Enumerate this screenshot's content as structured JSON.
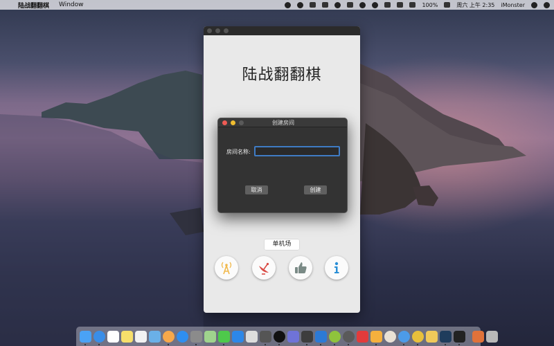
{
  "menubar": {
    "app_name": "陆战翻翻棋",
    "menus": [
      "Window"
    ],
    "battery": "100%",
    "clock": "周六 上午 2:35",
    "user": "iMonster"
  },
  "app_window": {
    "title": "陆战翻翻棋",
    "single_player_label": "单机场"
  },
  "dialog": {
    "title": "创建房间",
    "room_name_label": "房间名称:",
    "room_name_value": "",
    "cancel_label": "取消",
    "create_label": "创建"
  },
  "dock": {
    "apps": [
      "finder",
      "safari",
      "calendar",
      "notes",
      "textedit",
      "preview",
      "photos",
      "app-store",
      "system-preferences",
      "maps",
      "wechat",
      "messages",
      "unknown-1",
      "terminal-like",
      "qq",
      "discord-like",
      "video",
      "vscode",
      "android-studio",
      "browser-app",
      "gitkraken-like",
      "unknown-2",
      "pinbar",
      "chrome",
      "thumb",
      "photoshop",
      "kanji",
      "gift",
      "trash"
    ]
  },
  "colors": {
    "dialog_bg": "#333333",
    "input_focus": "#3f7cc5",
    "app_bg": "#e9e9e9"
  }
}
